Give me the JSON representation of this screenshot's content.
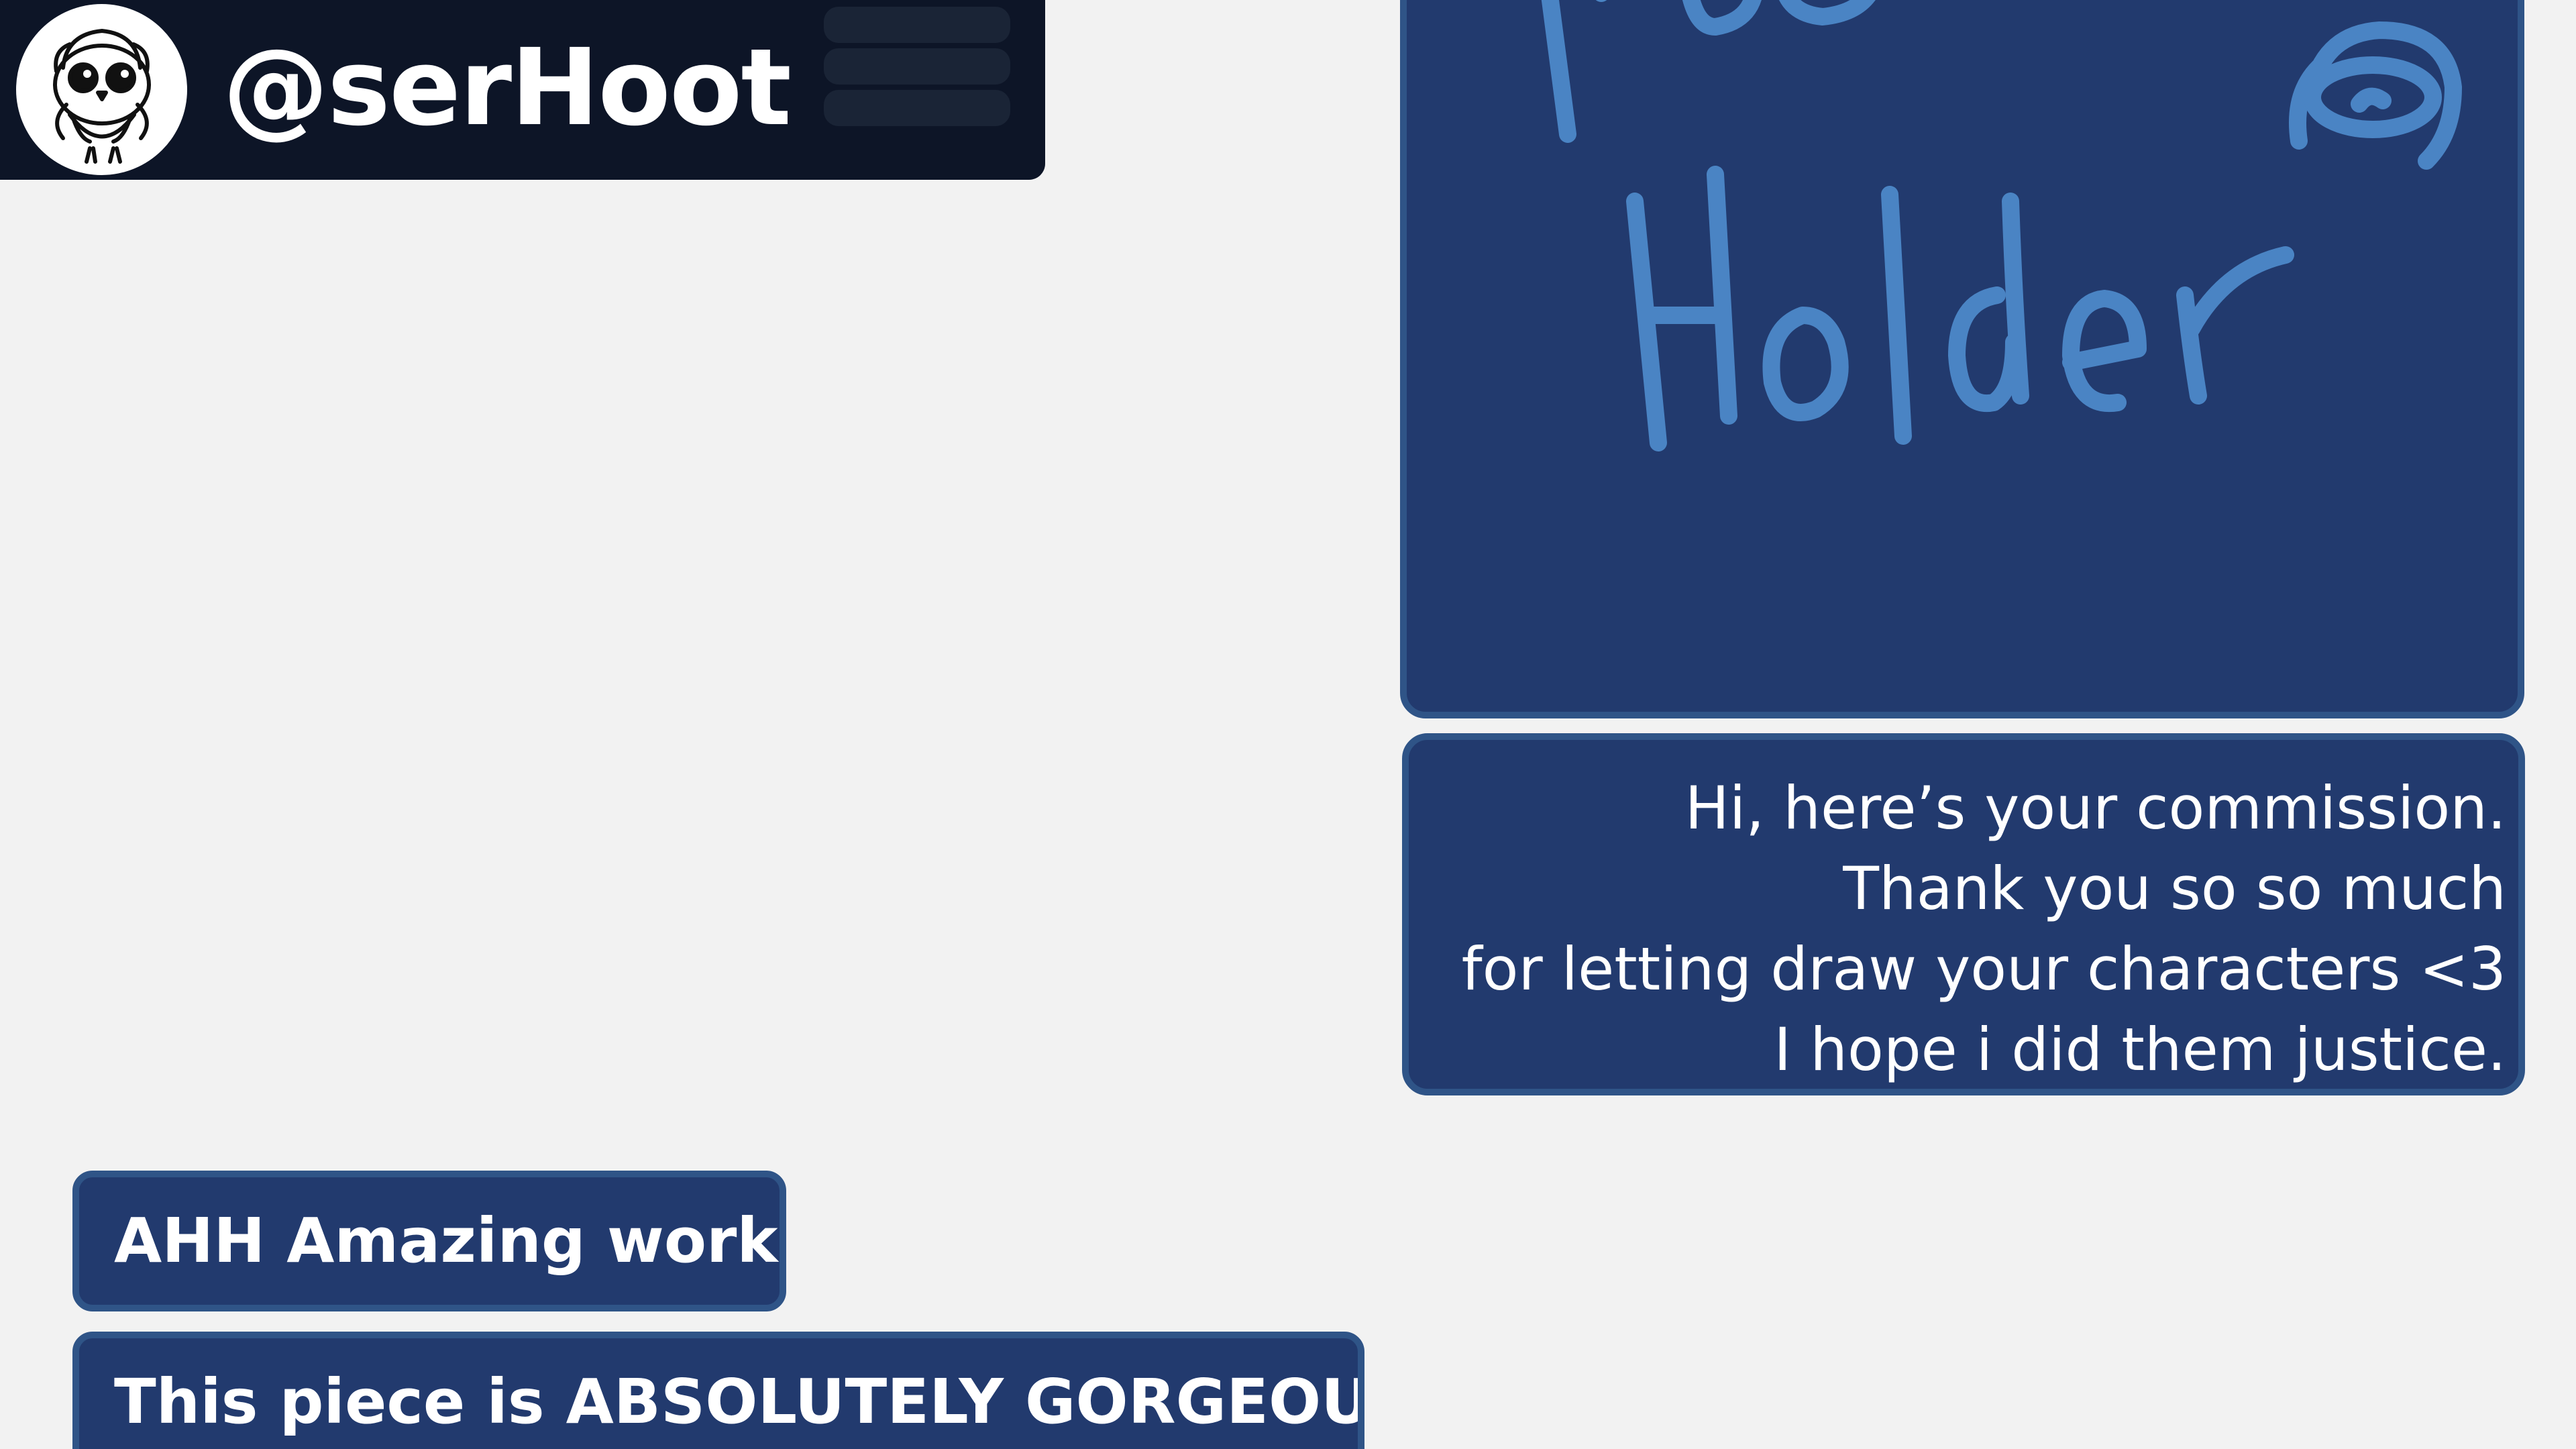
{
  "header": {
    "username": "@serHoot",
    "avatar_icon": "owl-avatar-icon",
    "menu_icon": "hamburger-menu-icon"
  },
  "image_message": {
    "placeholder_text_top": "Place",
    "placeholder_text_bottom": "Holder",
    "icon": "placeholder-drawing-icon"
  },
  "messages_right": [
    {
      "lines": [
        "Hi, here’s your commission.",
        "Thank you so so much",
        "for letting draw your characters <3",
        "I hope i did them justice."
      ]
    }
  ],
  "messages_left": [
    {
      "text": "AHH Amazing work!"
    },
    {
      "text": "This piece is ABSOLUTELY GORGEOUS"
    }
  ],
  "colors": {
    "background": "#f2f2f2",
    "header_bg": "#0d1527",
    "bubble_bg": "#223a6e",
    "bubble_border": "#2f5487",
    "placeholder_ink": "#4a84c4",
    "text": "#ffffff"
  }
}
